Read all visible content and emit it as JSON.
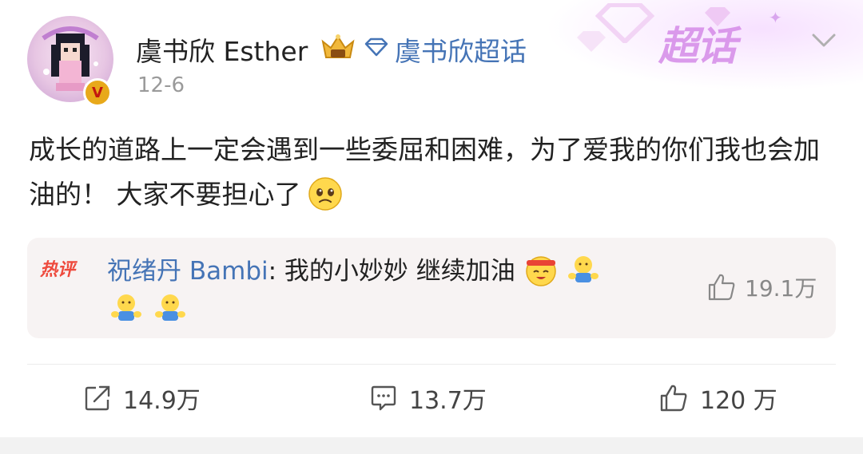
{
  "header": {
    "username": "虞书欣 Esther",
    "supertopic_name": "虞书欣超话",
    "date": "12-6",
    "banner_label": "超话",
    "verified_badge": "V"
  },
  "post": {
    "text": "成长的道路上一定会遇到一些委屈和困难，为了爱我的你们我也会加油的！ 大家不要担心了"
  },
  "hot_comment": {
    "label": "热评",
    "author": "祝绪丹 Bambi",
    "text": ": 我的小妙妙 继续加油",
    "like_count": "19.1万"
  },
  "actions": {
    "repost_count": "14.9万",
    "comment_count": "13.7万",
    "like_count": "120 万"
  },
  "icons": [
    "crown-icon",
    "diamond-icon",
    "chevron-down-icon",
    "sad-emoji-icon",
    "cheer-emoji-icon",
    "hug-emoji-icon",
    "thumbs-up-icon",
    "repost-icon",
    "comment-icon"
  ],
  "colors": {
    "link": "#4574b6",
    "hot": "#ee4a3d",
    "banner": "#d58be8",
    "badge": "#e8a91a"
  }
}
